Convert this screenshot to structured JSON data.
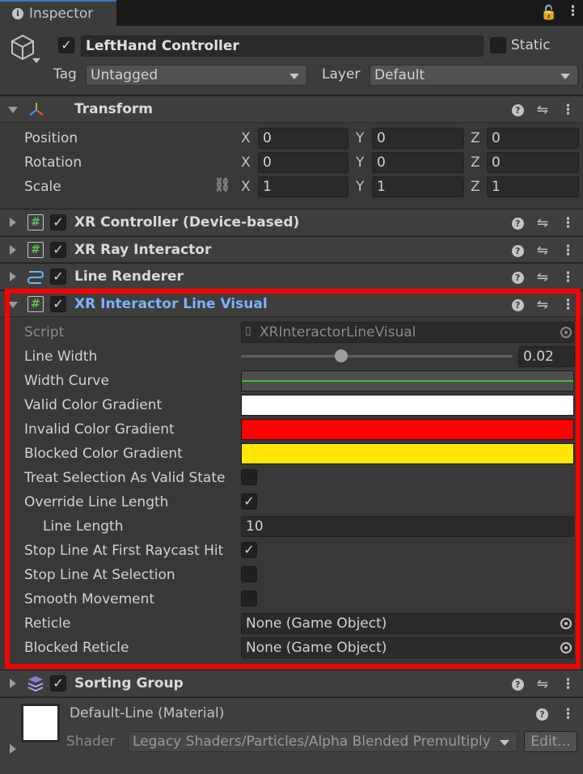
{
  "tab": {
    "label": "Inspector"
  },
  "object": {
    "name": "LeftHand Controller",
    "active": true,
    "static_label": "Static",
    "tag_label": "Tag",
    "tag": "Untagged",
    "layer_label": "Layer",
    "layer": "Default"
  },
  "transform": {
    "title": "Transform",
    "position_label": "Position",
    "rotation_label": "Rotation",
    "scale_label": "Scale",
    "x": "X",
    "y": "Y",
    "z": "Z",
    "position": [
      "0",
      "0",
      "0"
    ],
    "rotation": [
      "0",
      "0",
      "0"
    ],
    "scale": [
      "1",
      "1",
      "1"
    ]
  },
  "components": {
    "xr_controller": "XR Controller (Device-based)",
    "xr_ray": "XR Ray Interactor",
    "line_renderer": "Line Renderer",
    "line_visual": "XR Interactor Line Visual",
    "sorting_group": "Sorting Group"
  },
  "line_visual": {
    "script_label": "Script",
    "script": "XRInteractorLineVisual",
    "line_width_label": "Line Width",
    "line_width": "0.02",
    "line_width_fraction": 0.37,
    "width_curve_label": "Width Curve",
    "valid_label": "Valid Color Gradient",
    "valid_color": "#ffffff",
    "invalid_label": "Invalid Color Gradient",
    "invalid_color": "#ff0000",
    "blocked_label": "Blocked Color Gradient",
    "blocked_color": "#ffe600",
    "treat_label": "Treat Selection As Valid State",
    "treat": false,
    "override_label": "Override Line Length",
    "override": true,
    "line_length_label": "Line Length",
    "line_length": "10",
    "stop_raycast_label": "Stop Line At First Raycast Hit",
    "stop_raycast": true,
    "stop_selection_label": "Stop Line At Selection",
    "stop_selection": false,
    "smooth_label": "Smooth Movement",
    "smooth": false,
    "reticle_label": "Reticle",
    "reticle": "None (Game Object)",
    "blocked_reticle_label": "Blocked Reticle",
    "blocked_reticle": "None (Game Object)"
  },
  "material": {
    "name": "Default-Line (Material)",
    "shader_label": "Shader",
    "shader": "Legacy Shaders/Particles/Alpha Blended Premultiply",
    "edit": "Edit..."
  }
}
